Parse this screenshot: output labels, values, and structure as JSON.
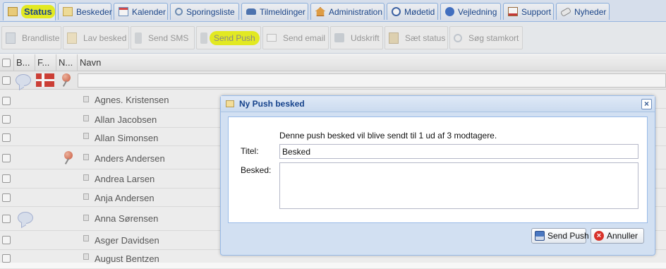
{
  "tabs": [
    {
      "label": "Status",
      "icon": "status-icon",
      "active": true
    },
    {
      "label": "Beskeder",
      "icon": "mail-icon"
    },
    {
      "label": "Kalender",
      "icon": "calendar-icon"
    },
    {
      "label": "Sporingsliste",
      "icon": "search-icon"
    },
    {
      "label": "Tilmeldinger",
      "icon": "car-icon"
    },
    {
      "label": "Administration",
      "icon": "house-icon"
    },
    {
      "label": "Mødetid",
      "icon": "clock-icon"
    },
    {
      "label": "Vejledning",
      "icon": "help-icon"
    },
    {
      "label": "Support",
      "icon": "support-icon"
    },
    {
      "label": "Nyheder",
      "icon": "news-icon"
    }
  ],
  "toolbar": [
    {
      "label": "Brandliste",
      "icon": "list-icon"
    },
    {
      "label": "Lav besked",
      "icon": "mail-icon"
    },
    {
      "label": "Send SMS",
      "icon": "phone-icon"
    },
    {
      "label": "Send Push",
      "icon": "phone-icon",
      "highlighted": true
    },
    {
      "label": "Send email",
      "icon": "envelope-icon"
    },
    {
      "label": "Udskrift",
      "icon": "printer-icon"
    },
    {
      "label": "Sæt status",
      "icon": "flag-icon"
    },
    {
      "label": "Søg stamkort",
      "icon": "magnifier-icon"
    }
  ],
  "grid": {
    "columns": [
      "B...",
      "F...",
      "N...",
      "Navn"
    ],
    "rows": [
      {
        "name": "Agnes. Kristensen"
      },
      {
        "name": "Allan Jacobsen"
      },
      {
        "name": "Allan Simonsen"
      },
      {
        "name": "Anders Andersen",
        "pin": true
      },
      {
        "name": "Andrea Larsen"
      },
      {
        "name": "Anja Andersen"
      },
      {
        "name": "Anna Sørensen",
        "bubble": true
      },
      {
        "name": "Asger Davidsen"
      },
      {
        "name": "August Bentzen"
      }
    ]
  },
  "dialog": {
    "title": "Ny Push besked",
    "info": "Denne push besked vil blive sendt til 1 ud af 3 modtagere.",
    "title_label": "Titel:",
    "title_value": "Besked",
    "message_label": "Besked:",
    "message_value": "",
    "send_label": "Send Push",
    "cancel_label": "Annuller",
    "close_symbol": "×"
  },
  "colors": {
    "highlight": "#ecf41c",
    "accent": "#15428b",
    "border": "#99bbe8"
  }
}
